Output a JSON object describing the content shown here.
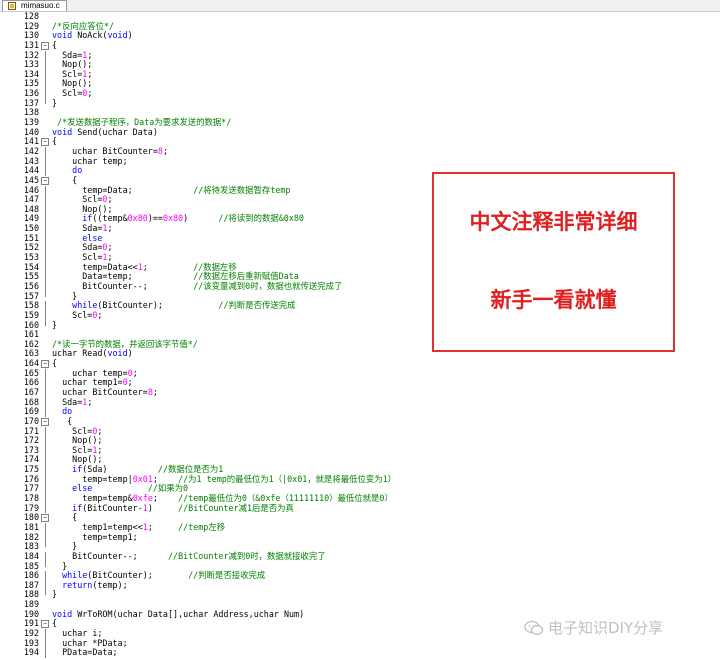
{
  "tab": {
    "label": "mimasuo.c"
  },
  "promo": {
    "line1": "中文注释非常详细",
    "line2": "新手一看就懂"
  },
  "watermark": {
    "text": "电子知识DIY分享",
    "icon": "wechat-icon"
  },
  "colors": {
    "keyword": "#0000ff",
    "comment": "#008000",
    "number": "#ff00ff",
    "promo_red": "#e02020"
  },
  "lines": [
    {
      "n": "128",
      "fold": "none",
      "tokens": []
    },
    {
      "n": "129",
      "fold": "none",
      "tokens": [
        {
          "c": "cm",
          "t": "/*反向应答位*/"
        }
      ]
    },
    {
      "n": "130",
      "fold": "none",
      "tokens": [
        {
          "c": "kw",
          "t": "void"
        },
        {
          "c": "",
          "t": " NoAck("
        },
        {
          "c": "kw",
          "t": "void"
        },
        {
          "c": "",
          "t": ")"
        }
      ]
    },
    {
      "n": "131",
      "fold": "open",
      "tokens": [
        {
          "c": "",
          "t": "{"
        }
      ]
    },
    {
      "n": "132",
      "fold": "line",
      "tokens": [
        {
          "c": "",
          "t": "  Sda="
        },
        {
          "c": "num",
          "t": "1"
        },
        {
          "c": "",
          "t": ";"
        }
      ]
    },
    {
      "n": "133",
      "fold": "line",
      "tokens": [
        {
          "c": "",
          "t": "  Nop();"
        }
      ]
    },
    {
      "n": "134",
      "fold": "line",
      "tokens": [
        {
          "c": "",
          "t": "  Scl="
        },
        {
          "c": "num",
          "t": "1"
        },
        {
          "c": "",
          "t": ";"
        }
      ]
    },
    {
      "n": "135",
      "fold": "line",
      "tokens": [
        {
          "c": "",
          "t": "  Nop();"
        }
      ]
    },
    {
      "n": "136",
      "fold": "line",
      "tokens": [
        {
          "c": "",
          "t": "  Scl="
        },
        {
          "c": "num",
          "t": "0"
        },
        {
          "c": "",
          "t": ";"
        }
      ]
    },
    {
      "n": "137",
      "fold": "end",
      "tokens": [
        {
          "c": "",
          "t": "}"
        }
      ]
    },
    {
      "n": "138",
      "fold": "none",
      "tokens": []
    },
    {
      "n": "139",
      "fold": "none",
      "tokens": [
        {
          "c": "cm",
          "t": " /*发送数据子程序，Data为要求发送的数据*/"
        }
      ]
    },
    {
      "n": "140",
      "fold": "none",
      "tokens": [
        {
          "c": "kw",
          "t": "void"
        },
        {
          "c": "",
          "t": " Send(uchar Data)"
        }
      ]
    },
    {
      "n": "141",
      "fold": "open",
      "tokens": [
        {
          "c": "",
          "t": "{"
        }
      ]
    },
    {
      "n": "142",
      "fold": "line",
      "tokens": [
        {
          "c": "",
          "t": "    uchar BitCounter="
        },
        {
          "c": "num",
          "t": "8"
        },
        {
          "c": "",
          "t": ";"
        }
      ]
    },
    {
      "n": "143",
      "fold": "line",
      "tokens": [
        {
          "c": "",
          "t": "    uchar temp;"
        }
      ]
    },
    {
      "n": "144",
      "fold": "line",
      "tokens": [
        {
          "c": "kw",
          "t": "    do"
        }
      ]
    },
    {
      "n": "145",
      "fold": "open",
      "tokens": [
        {
          "c": "",
          "t": "    {"
        }
      ]
    },
    {
      "n": "146",
      "fold": "line",
      "tokens": [
        {
          "c": "",
          "t": "      temp=Data;            "
        },
        {
          "c": "cm",
          "t": "//将待发送数据暂存temp"
        }
      ]
    },
    {
      "n": "147",
      "fold": "line",
      "tokens": [
        {
          "c": "",
          "t": "      Scl="
        },
        {
          "c": "num",
          "t": "0"
        },
        {
          "c": "",
          "t": ";"
        }
      ]
    },
    {
      "n": "148",
      "fold": "line",
      "tokens": [
        {
          "c": "",
          "t": "      Nop();"
        }
      ]
    },
    {
      "n": "149",
      "fold": "line",
      "tokens": [
        {
          "c": "kw",
          "t": "      if"
        },
        {
          "c": "",
          "t": "((temp&"
        },
        {
          "c": "num",
          "t": "0x80"
        },
        {
          "c": "",
          "t": ")=="
        },
        {
          "c": "num",
          "t": "0x80"
        },
        {
          "c": "",
          "t": ")      "
        },
        {
          "c": "cm",
          "t": "//将读到的数据&0x80"
        }
      ]
    },
    {
      "n": "150",
      "fold": "line",
      "tokens": [
        {
          "c": "",
          "t": "      Sda="
        },
        {
          "c": "num",
          "t": "1"
        },
        {
          "c": "",
          "t": ";"
        }
      ]
    },
    {
      "n": "151",
      "fold": "line",
      "tokens": [
        {
          "c": "kw",
          "t": "      else"
        }
      ]
    },
    {
      "n": "152",
      "fold": "line",
      "tokens": [
        {
          "c": "",
          "t": "      Sda="
        },
        {
          "c": "num",
          "t": "0"
        },
        {
          "c": "",
          "t": ";"
        }
      ]
    },
    {
      "n": "153",
      "fold": "line",
      "tokens": [
        {
          "c": "",
          "t": "      Scl="
        },
        {
          "c": "num",
          "t": "1"
        },
        {
          "c": "",
          "t": ";"
        }
      ]
    },
    {
      "n": "154",
      "fold": "line",
      "tokens": [
        {
          "c": "",
          "t": "      temp=Data<<"
        },
        {
          "c": "num",
          "t": "1"
        },
        {
          "c": "",
          "t": ";         "
        },
        {
          "c": "cm",
          "t": "//数据左移"
        }
      ]
    },
    {
      "n": "155",
      "fold": "line",
      "tokens": [
        {
          "c": "",
          "t": "      Data=temp;            "
        },
        {
          "c": "cm",
          "t": "//数据左移后重新赋值Data"
        }
      ]
    },
    {
      "n": "156",
      "fold": "line",
      "tokens": [
        {
          "c": "",
          "t": "      BitCounter--;         "
        },
        {
          "c": "cm",
          "t": "//该变量减到0时，数据也就传送完成了"
        }
      ]
    },
    {
      "n": "157",
      "fold": "end",
      "tokens": [
        {
          "c": "",
          "t": "    }"
        }
      ]
    },
    {
      "n": "158",
      "fold": "line",
      "tokens": [
        {
          "c": "kw",
          "t": "    while"
        },
        {
          "c": "",
          "t": "(BitCounter);           "
        },
        {
          "c": "cm",
          "t": "//判断是否传送完成"
        }
      ]
    },
    {
      "n": "159",
      "fold": "line",
      "tokens": [
        {
          "c": "",
          "t": "    Scl="
        },
        {
          "c": "num",
          "t": "0"
        },
        {
          "c": "",
          "t": ";"
        }
      ]
    },
    {
      "n": "160",
      "fold": "end",
      "tokens": [
        {
          "c": "",
          "t": "}"
        }
      ]
    },
    {
      "n": "161",
      "fold": "none",
      "tokens": []
    },
    {
      "n": "162",
      "fold": "none",
      "tokens": [
        {
          "c": "cm",
          "t": "/*读一字节的数据，并返回该字节值*/"
        }
      ]
    },
    {
      "n": "163",
      "fold": "none",
      "tokens": [
        {
          "c": "",
          "t": "uchar Read("
        },
        {
          "c": "kw",
          "t": "void"
        },
        {
          "c": "",
          "t": ")"
        }
      ]
    },
    {
      "n": "164",
      "fold": "open",
      "tokens": [
        {
          "c": "",
          "t": "{"
        }
      ]
    },
    {
      "n": "165",
      "fold": "line",
      "tokens": [
        {
          "c": "",
          "t": "    uchar temp="
        },
        {
          "c": "num",
          "t": "0"
        },
        {
          "c": "",
          "t": ";"
        }
      ]
    },
    {
      "n": "166",
      "fold": "line",
      "tokens": [
        {
          "c": "",
          "t": "  uchar temp1="
        },
        {
          "c": "num",
          "t": "0"
        },
        {
          "c": "",
          "t": ";"
        }
      ]
    },
    {
      "n": "167",
      "fold": "line",
      "tokens": [
        {
          "c": "",
          "t": "  uchar BitCounter="
        },
        {
          "c": "num",
          "t": "8"
        },
        {
          "c": "",
          "t": ";"
        }
      ]
    },
    {
      "n": "168",
      "fold": "line",
      "tokens": [
        {
          "c": "",
          "t": "  Sda="
        },
        {
          "c": "num",
          "t": "1"
        },
        {
          "c": "",
          "t": ";"
        }
      ]
    },
    {
      "n": "169",
      "fold": "line",
      "tokens": [
        {
          "c": "kw",
          "t": "  do"
        }
      ]
    },
    {
      "n": "170",
      "fold": "open",
      "tokens": [
        {
          "c": "",
          "t": "   {"
        }
      ]
    },
    {
      "n": "171",
      "fold": "line",
      "tokens": [
        {
          "c": "",
          "t": "    Scl="
        },
        {
          "c": "num",
          "t": "0"
        },
        {
          "c": "",
          "t": ";"
        }
      ]
    },
    {
      "n": "172",
      "fold": "line",
      "tokens": [
        {
          "c": "",
          "t": "    Nop();"
        }
      ]
    },
    {
      "n": "173",
      "fold": "line",
      "tokens": [
        {
          "c": "",
          "t": "    Scl="
        },
        {
          "c": "num",
          "t": "1"
        },
        {
          "c": "",
          "t": ";"
        }
      ]
    },
    {
      "n": "174",
      "fold": "line",
      "tokens": [
        {
          "c": "",
          "t": "    Nop();"
        }
      ]
    },
    {
      "n": "175",
      "fold": "line",
      "tokens": [
        {
          "c": "kw",
          "t": "    if"
        },
        {
          "c": "",
          "t": "(Sda)          "
        },
        {
          "c": "cm",
          "t": "//数据位是否为1"
        }
      ]
    },
    {
      "n": "176",
      "fold": "line",
      "tokens": [
        {
          "c": "",
          "t": "      temp=temp|"
        },
        {
          "c": "num",
          "t": "0x01"
        },
        {
          "c": "",
          "t": ";    "
        },
        {
          "c": "cm",
          "t": "//为1 temp的最低位为1（|0x01，就是将最低位变为1）"
        }
      ]
    },
    {
      "n": "177",
      "fold": "line",
      "tokens": [
        {
          "c": "kw",
          "t": "    else"
        },
        {
          "c": "",
          "t": "           "
        },
        {
          "c": "cm",
          "t": "//如果为0"
        }
      ]
    },
    {
      "n": "178",
      "fold": "line",
      "tokens": [
        {
          "c": "",
          "t": "      temp=temp&"
        },
        {
          "c": "num",
          "t": "0xfe"
        },
        {
          "c": "",
          "t": ";    "
        },
        {
          "c": "cm",
          "t": "//temp最低位为0（&0xfe（11111110）最低位就是0）"
        }
      ]
    },
    {
      "n": "179",
      "fold": "line",
      "tokens": [
        {
          "c": "kw",
          "t": "    if"
        },
        {
          "c": "",
          "t": "(BitCounter-"
        },
        {
          "c": "num",
          "t": "1"
        },
        {
          "c": "",
          "t": ")     "
        },
        {
          "c": "cm",
          "t": "//BitCounter减1后是否为真"
        }
      ]
    },
    {
      "n": "180",
      "fold": "open",
      "tokens": [
        {
          "c": "",
          "t": "    {"
        }
      ]
    },
    {
      "n": "181",
      "fold": "line",
      "tokens": [
        {
          "c": "",
          "t": "      temp1=temp<<"
        },
        {
          "c": "num",
          "t": "1"
        },
        {
          "c": "",
          "t": ";     "
        },
        {
          "c": "cm",
          "t": "//temp左移"
        }
      ]
    },
    {
      "n": "182",
      "fold": "line",
      "tokens": [
        {
          "c": "",
          "t": "      temp=temp1;"
        }
      ]
    },
    {
      "n": "183",
      "fold": "end",
      "tokens": [
        {
          "c": "",
          "t": "    }"
        }
      ]
    },
    {
      "n": "184",
      "fold": "line",
      "tokens": [
        {
          "c": "",
          "t": "    BitCounter--;      "
        },
        {
          "c": "cm",
          "t": "//BitCounter减到0时，数据就接收完了"
        }
      ]
    },
    {
      "n": "185",
      "fold": "end",
      "tokens": [
        {
          "c": "",
          "t": "  }"
        }
      ]
    },
    {
      "n": "186",
      "fold": "line",
      "tokens": [
        {
          "c": "kw",
          "t": "  while"
        },
        {
          "c": "",
          "t": "(BitCounter);       "
        },
        {
          "c": "cm",
          "t": "//判断是否接收完成"
        }
      ]
    },
    {
      "n": "187",
      "fold": "line",
      "tokens": [
        {
          "c": "kw",
          "t": "  return"
        },
        {
          "c": "",
          "t": "(temp);"
        }
      ]
    },
    {
      "n": "188",
      "fold": "end",
      "tokens": [
        {
          "c": "",
          "t": "}"
        }
      ]
    },
    {
      "n": "189",
      "fold": "none",
      "tokens": []
    },
    {
      "n": "190",
      "fold": "none",
      "tokens": [
        {
          "c": "kw",
          "t": "void"
        },
        {
          "c": "",
          "t": " WrToROM(uchar Data[],uchar Address,uchar Num)"
        }
      ]
    },
    {
      "n": "191",
      "fold": "open",
      "tokens": [
        {
          "c": "",
          "t": "{"
        }
      ]
    },
    {
      "n": "192",
      "fold": "line",
      "tokens": [
        {
          "c": "",
          "t": "  uchar i;"
        }
      ]
    },
    {
      "n": "193",
      "fold": "line",
      "tokens": [
        {
          "c": "",
          "t": "  uchar *PData;"
        }
      ]
    },
    {
      "n": "194",
      "fold": "line",
      "tokens": [
        {
          "c": "",
          "t": "  PData=Data;"
        }
      ]
    }
  ]
}
